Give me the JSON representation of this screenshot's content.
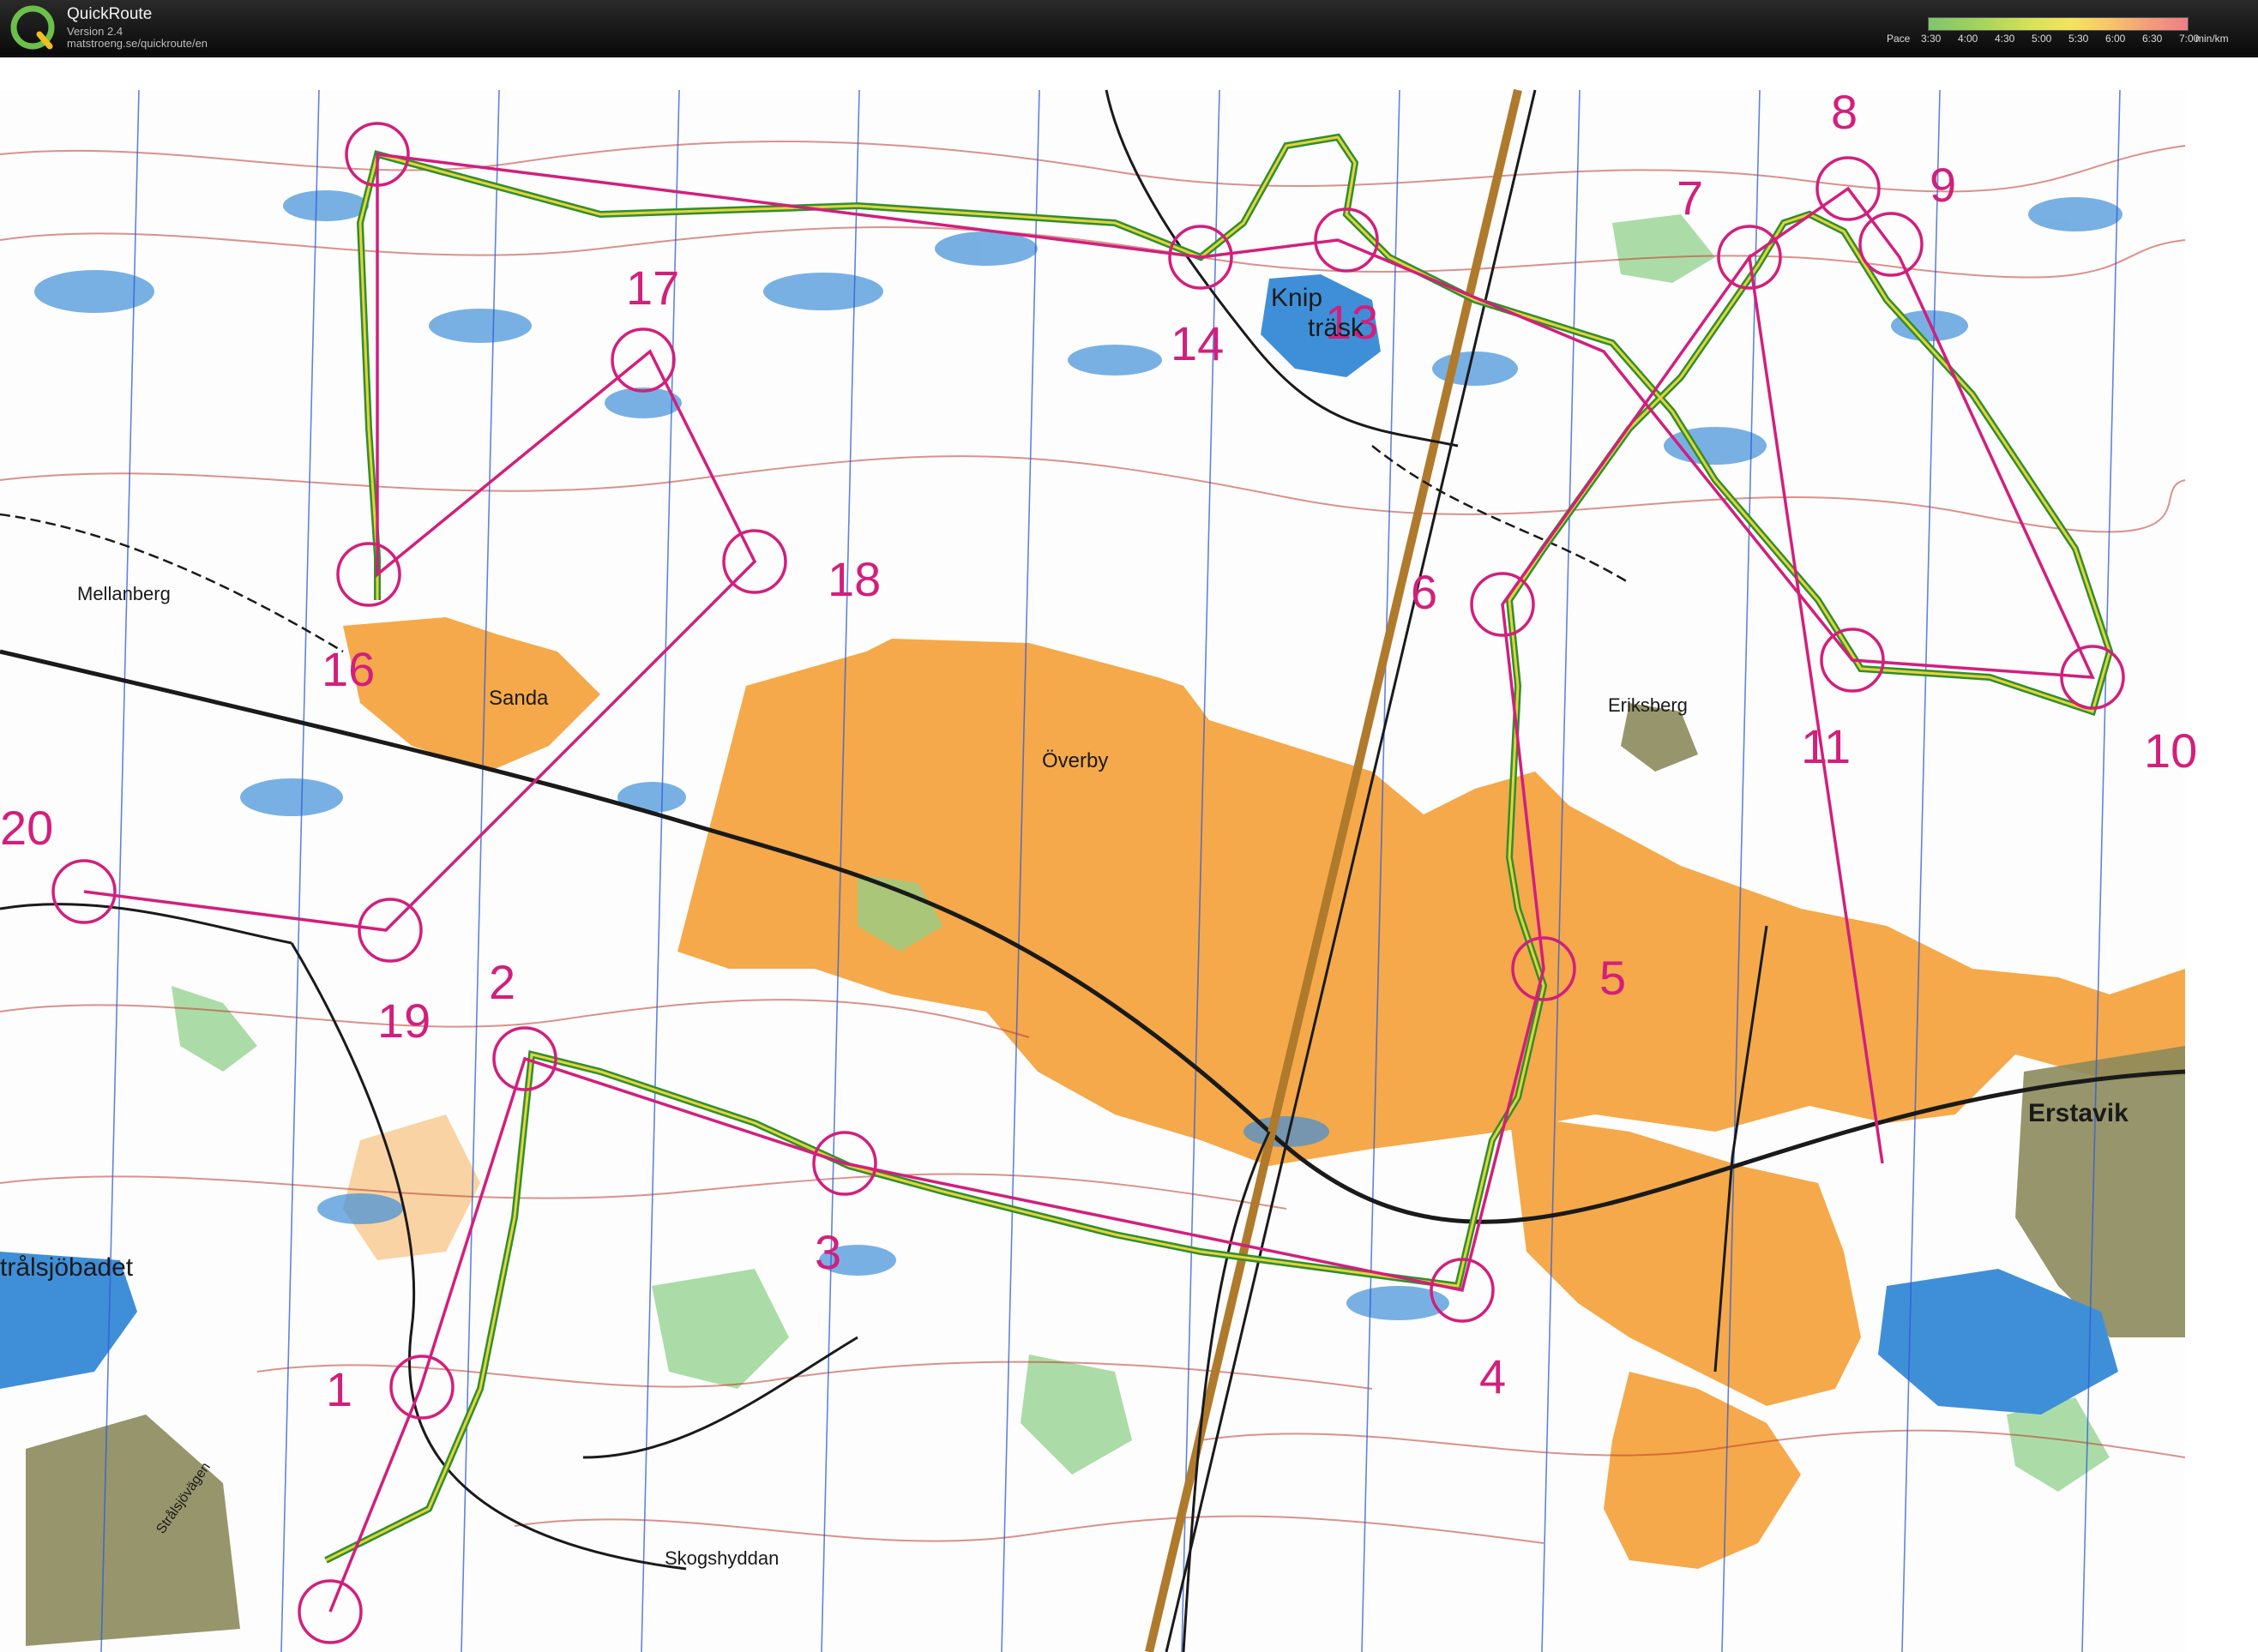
{
  "header": {
    "title": "QuickRoute",
    "version": "Version 2.4",
    "url": "matstroeng.se/quickroute/en"
  },
  "pace_legend": {
    "label": "Pace",
    "ticks": [
      "3:30",
      "4:00",
      "4:30",
      "5:00",
      "5:30",
      "6:00",
      "6:30",
      "7:00"
    ],
    "unit": "min/km",
    "colors": [
      "#7fc46e",
      "#a6d35c",
      "#d7e25a",
      "#f4e35e",
      "#f6c56a",
      "#f39d7a",
      "#ee7e88"
    ]
  },
  "map": {
    "colors": {
      "open_land": "#f5a94a",
      "water": "#3f8fd8",
      "green": "#8fd08a",
      "contour": "#c0392b",
      "course": "#d21f7c",
      "route_outer": "#2f8f2f",
      "route_inner": "#e6d23a",
      "meridian": "#2d5bd6",
      "road": "#1a1a1a",
      "built_up": "#8c8a5b"
    },
    "place_names": {
      "mellanberg": "Mellanberg",
      "sanda": "Sanda",
      "overby": "Överby",
      "eriksberg": "Eriksberg",
      "erstavik": "Erstavik",
      "knip": "Knip",
      "trask": "träsk",
      "stralsjobadet": "trålsjöbadet",
      "skogshyddan": "Skogshyddan",
      "stralsjovagen": "Strålsjövägen"
    },
    "control_numbers": [
      "1",
      "2",
      "3",
      "4",
      "5",
      "6",
      "7",
      "8",
      "9",
      "10",
      "11",
      "13",
      "14",
      "16",
      "17",
      "18",
      "19",
      "20"
    ]
  }
}
